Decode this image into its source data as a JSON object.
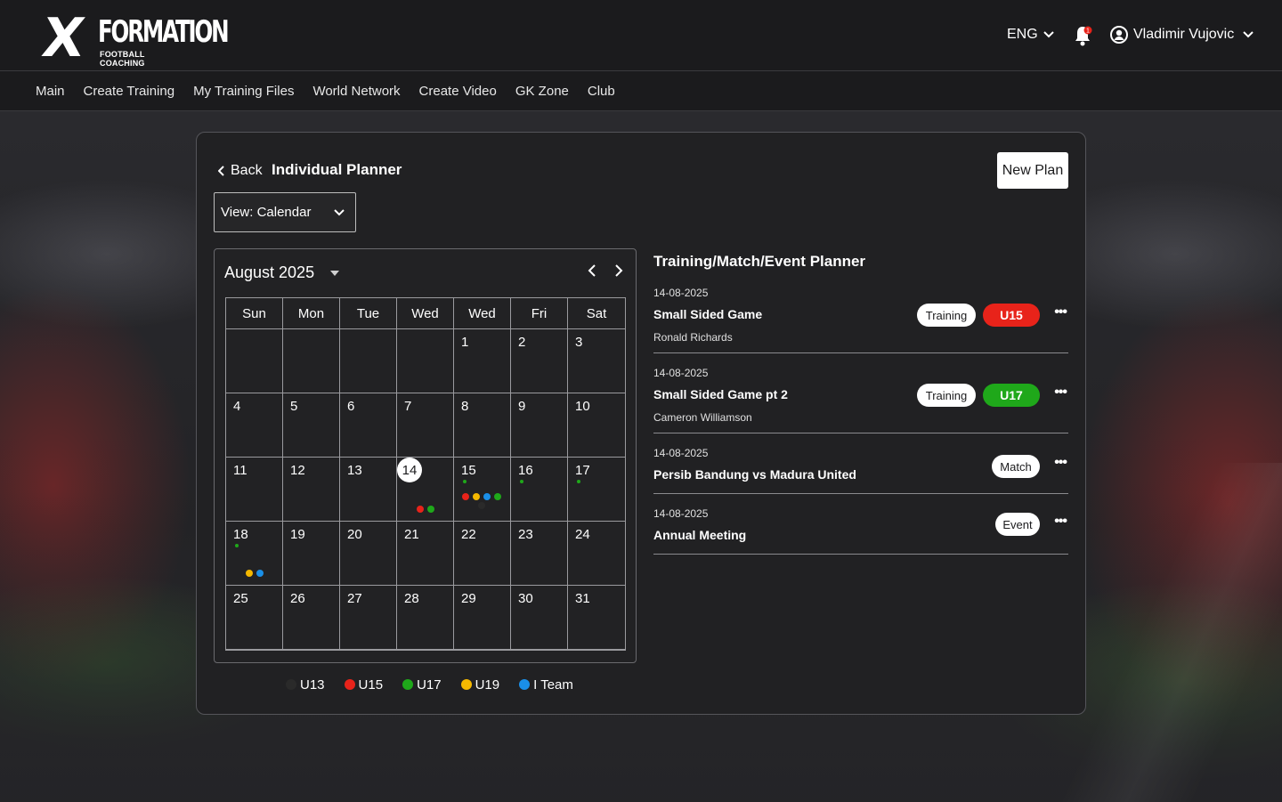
{
  "brand": {
    "logo_x": "X",
    "logo_word": "FORMATION",
    "logo_sub": "FOOTBALL COACHING"
  },
  "header": {
    "language": "ENG",
    "notification_count": "1",
    "user_name": "Vladimir Vujovic"
  },
  "nav": [
    "Main",
    "Create Training",
    "My Training Files",
    "World Network",
    "Create Video",
    "GK Zone",
    "Club"
  ],
  "page": {
    "back_label": "Back",
    "title": "Individual Planner",
    "new_plan_label": "New Plan",
    "view_select": "View: Calendar"
  },
  "calendar": {
    "month_label": "August 2025",
    "weekdays": [
      "Sun",
      "Mon",
      "Tue",
      "Wed",
      "Wed",
      "Fri",
      "Sat"
    ],
    "weeks": [
      [
        "",
        "",
        "",
        "",
        "1",
        "2",
        "3"
      ],
      [
        "4",
        "5",
        "6",
        "7",
        "8",
        "9",
        "10"
      ],
      [
        "11",
        "12",
        "13",
        "14",
        "15",
        "16",
        "17"
      ],
      [
        "18",
        "19",
        "20",
        "21",
        "22",
        "23",
        "24"
      ],
      [
        "25",
        "26",
        "27",
        "28",
        "29",
        "30",
        "31"
      ]
    ],
    "today": "14",
    "markers": {
      "14": {
        "small": [],
        "row": [
          "U15",
          "U17"
        ]
      },
      "15": {
        "small": [
          "U17"
        ],
        "row": [
          "U15",
          "U19",
          "I Team",
          "U17"
        ],
        "under": [
          "U13"
        ]
      },
      "16": {
        "small": [
          "U17"
        ],
        "row": []
      },
      "17": {
        "small": [
          "U17"
        ],
        "row": []
      },
      "18": {
        "small": [
          "U17"
        ],
        "row": [
          "U19",
          "I Team"
        ]
      }
    }
  },
  "legend": [
    {
      "label": "U13",
      "color": "#2a2a2a"
    },
    {
      "label": "U15",
      "color": "#e8231a"
    },
    {
      "label": "U17",
      "color": "#1fa81a"
    },
    {
      "label": "U19",
      "color": "#f5b800"
    },
    {
      "label": "I Team",
      "color": "#1a8fe8"
    }
  ],
  "planner": {
    "title": "Training/Match/Event Planner",
    "entries": [
      {
        "date": "14-08-2025",
        "name": "Small Sided Game",
        "coach": "Ronald Richards",
        "type": "Training",
        "team": "U15",
        "team_color": "#e8231a"
      },
      {
        "date": "14-08-2025",
        "name": "Small Sided Game pt 2",
        "coach": "Cameron Williamson",
        "type": "Training",
        "team": "U17",
        "team_color": "#1fa81a"
      },
      {
        "date": "14-08-2025",
        "name": "Persib Bandung vs Madura United",
        "coach": "",
        "type": "Match",
        "team": "",
        "team_color": ""
      },
      {
        "date": "14-08-2025",
        "name": "Annual Meeting",
        "coach": "",
        "type": "Event",
        "team": "",
        "team_color": ""
      }
    ]
  }
}
